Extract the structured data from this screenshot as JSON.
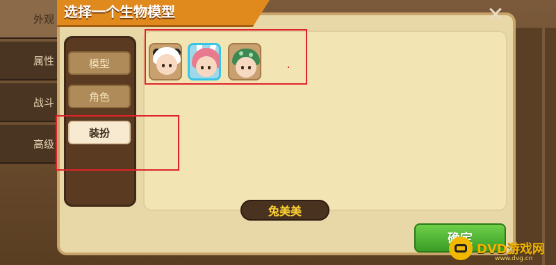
{
  "dialog": {
    "title": "选择一个生物模型",
    "close_symbol": "✕",
    "categories": [
      {
        "label": "模型",
        "state": "inactive"
      },
      {
        "label": "角色",
        "state": "inactive"
      },
      {
        "label": "装扮",
        "state": "active"
      }
    ],
    "items": [
      {
        "icon": "panda-hood-avatar-icon",
        "selected": false
      },
      {
        "icon": "bunny-girl-avatar-icon",
        "selected": true
      },
      {
        "icon": "dino-hood-avatar-icon",
        "selected": false
      }
    ],
    "selected_name": "兔美美",
    "confirm_label": "确定"
  },
  "background": {
    "tabs": [
      "外观",
      "属性",
      "战斗",
      "高级"
    ]
  },
  "watermark": {
    "text": "DVD游戏网",
    "sub": "www.dvg.cn"
  },
  "colors": {
    "ribbon": "#e08a1e",
    "panel": "#e8d8a8",
    "confirm": "#3a9d25",
    "annotation": "#e0222c",
    "selected_border": "#37c4e6"
  }
}
